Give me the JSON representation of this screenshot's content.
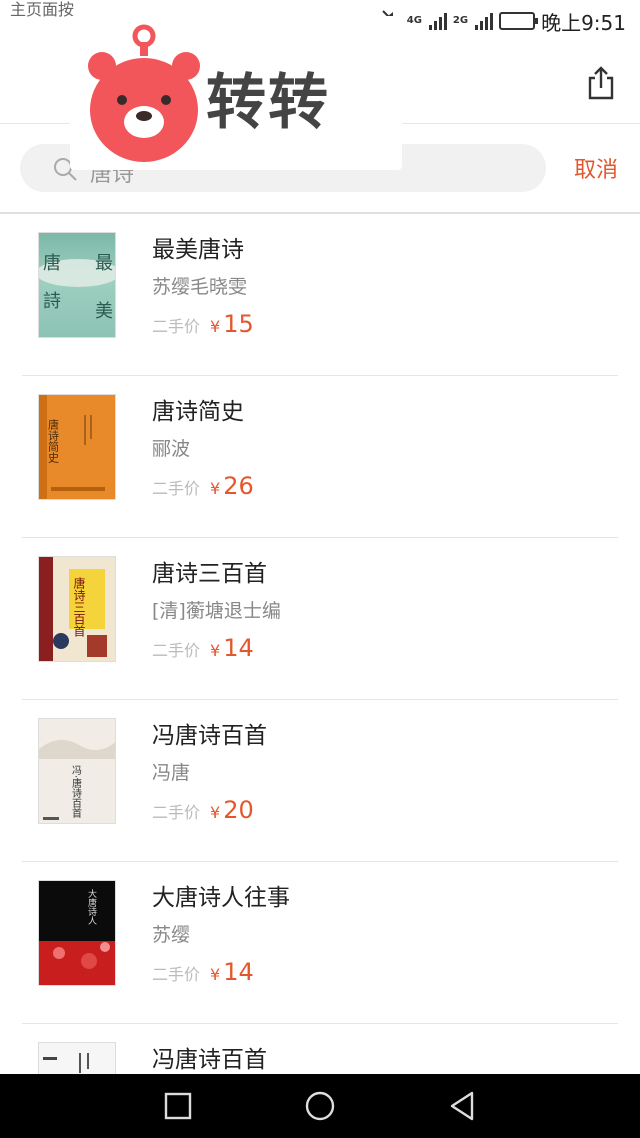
{
  "status_bar": {
    "left_text": "主页面按",
    "time": "晚上9:51",
    "net1": "4G",
    "net2": "2G"
  },
  "logo": {
    "brand_text": "转转"
  },
  "search": {
    "query": "唐诗",
    "cancel_label": "取消"
  },
  "results": [
    {
      "title": "最美唐诗",
      "author": "苏缨毛晓雯",
      "price_label": "二手价",
      "currency": "¥",
      "price": "15"
    },
    {
      "title": "唐诗简史",
      "author": "郦波",
      "price_label": "二手价",
      "currency": "¥",
      "price": "26"
    },
    {
      "title": "唐诗三百首",
      "author": "[清]蘅塘退士编",
      "price_label": "二手价",
      "currency": "¥",
      "price": "14"
    },
    {
      "title": "冯唐诗百首",
      "author": "冯唐",
      "price_label": "二手价",
      "currency": "¥",
      "price": "20"
    },
    {
      "title": "大唐诗人往事",
      "author": "苏缨",
      "price_label": "二手价",
      "currency": "¥",
      "price": "14"
    },
    {
      "title": "冯唐诗百首"
    }
  ],
  "covers": [
    {
      "l1": "唐",
      "l2": "詩",
      "r1": "最",
      "r2": "美"
    },
    {
      "text": "唐诗简史"
    },
    {
      "text": "唐诗三百首"
    },
    {
      "text": "冯·唐诗百首"
    },
    {
      "text": "大唐诗人"
    }
  ],
  "colors": {
    "accent": "#e4572e",
    "logo_red": "#f2555a"
  }
}
